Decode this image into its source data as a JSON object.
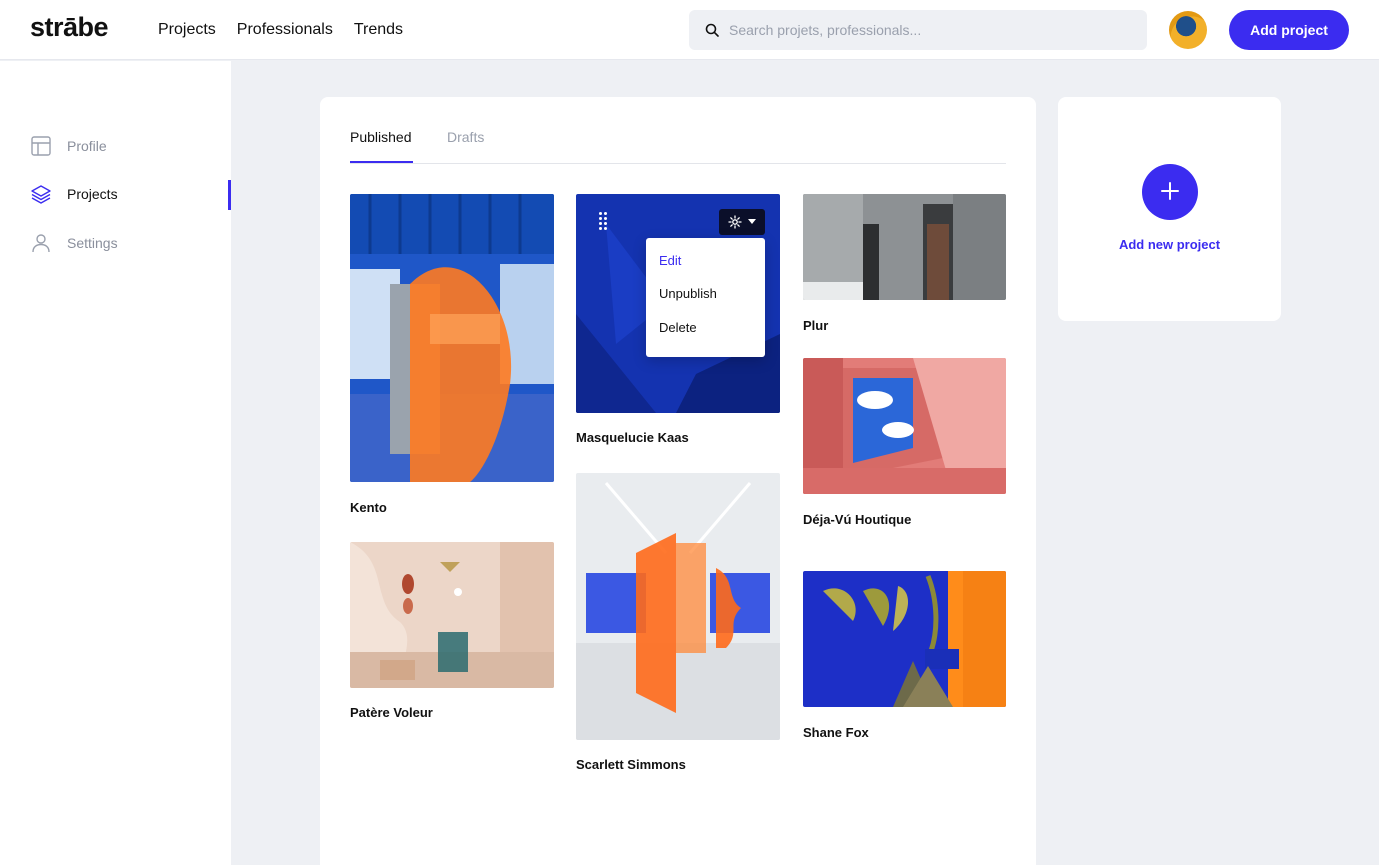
{
  "header": {
    "logo": "strābe",
    "nav": [
      "Projects",
      "Professionals",
      "Trends"
    ],
    "search_placeholder": "Search projets, professionals...",
    "add_project_label": "Add project"
  },
  "sidebar": {
    "items": [
      {
        "label": "Profile",
        "icon": "layout-icon",
        "active": false
      },
      {
        "label": "Projects",
        "icon": "layers-icon",
        "active": true
      },
      {
        "label": "Settings",
        "icon": "user-icon",
        "active": false
      }
    ]
  },
  "main": {
    "tabs": [
      {
        "label": "Published",
        "active": true
      },
      {
        "label": "Drafts",
        "active": false
      }
    ],
    "projects": [
      {
        "title": "Kento"
      },
      {
        "title": "Patère Voleur"
      },
      {
        "title": "Masquelucie Kaas"
      },
      {
        "title": "Scarlett Simmons"
      },
      {
        "title": "Plur"
      },
      {
        "title": "Déja-Vú Houtique"
      },
      {
        "title": "Shane Fox"
      }
    ],
    "context_menu": {
      "items": [
        "Edit",
        "Unpublish",
        "Delete"
      ]
    }
  },
  "right_card": {
    "add_new_label": "Add new project"
  },
  "colors": {
    "accent": "#3b2cf0",
    "background": "#eef0f4"
  }
}
